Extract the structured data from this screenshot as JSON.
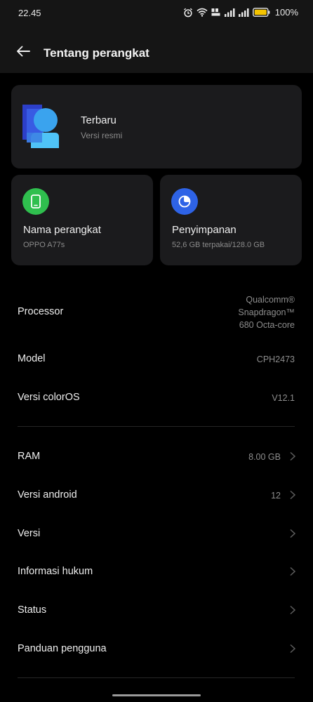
{
  "status_bar": {
    "time": "22.45",
    "battery_percent": "100%",
    "icons": [
      "alarm-icon",
      "wifi-icon",
      "volte-icon",
      "signal-icon",
      "signal-icon",
      "battery-icon"
    ],
    "battery_color": "#f5c400"
  },
  "header": {
    "title": "Tentang perangkat",
    "back_icon": "arrow-left-icon"
  },
  "update_card": {
    "title": "Terbaru",
    "subtitle": "Versi resmi",
    "logo_icon": "coloros-logo-icon"
  },
  "device_card": {
    "title": "Nama perangkat",
    "subtitle": "OPPO A77s",
    "icon": "phone-icon",
    "icon_color": "#2fbf4e"
  },
  "storage_card": {
    "title": "Penyimpanan",
    "subtitle": "52,6 GB terpakai/128.0 GB",
    "icon": "pie-chart-icon",
    "icon_color": "#2e63e6"
  },
  "info_rows": [
    {
      "label": "Processor",
      "value_lines": [
        "Qualcomm®",
        "Snapdragon™",
        "680 Octa-core"
      ]
    },
    {
      "label": "Model",
      "value": "CPH2473"
    },
    {
      "label": "Versi colorOS",
      "value": "V12.1"
    }
  ],
  "nav_rows": [
    {
      "label": "RAM",
      "value": "8.00 GB"
    },
    {
      "label": "Versi android",
      "value": "12"
    },
    {
      "label": "Versi",
      "value": ""
    },
    {
      "label": "Informasi hukum",
      "value": ""
    },
    {
      "label": "Status",
      "value": ""
    },
    {
      "label": "Panduan pengguna",
      "value": ""
    }
  ]
}
